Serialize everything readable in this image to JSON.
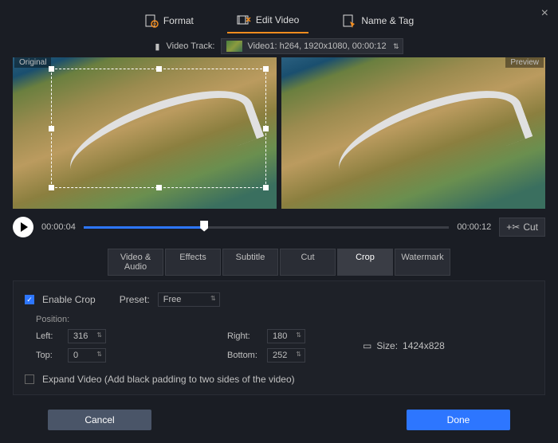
{
  "topTabs": {
    "format": "Format",
    "editVideo": "Edit Video",
    "nameTag": "Name & Tag"
  },
  "track": {
    "label": "Video Track:",
    "value": "Video1: h264, 1920x1080, 00:00:12"
  },
  "previews": {
    "original": "Original",
    "preview": "Preview"
  },
  "player": {
    "curTime": "00:00:04",
    "totTime": "00:00:12",
    "progressPct": 33,
    "cutLabel": "Cut"
  },
  "subTabs": [
    "Video & Audio",
    "Effects",
    "Subtitle",
    "Cut",
    "Crop",
    "Watermark"
  ],
  "crop": {
    "enableLabel": "Enable Crop",
    "presetLabel": "Preset:",
    "presetValue": "Free",
    "positionLabel": "Position:",
    "leftLabel": "Left:",
    "leftVal": "316",
    "topLabel": "Top:",
    "topVal": "0",
    "rightLabel": "Right:",
    "rightVal": "180",
    "bottomLabel": "Bottom:",
    "bottomVal": "252",
    "sizeLabel": "Size:",
    "sizeVal": "1424x828",
    "expandLabel": "Expand Video (Add black padding to two sides of the video)"
  },
  "buttons": {
    "cancel": "Cancel",
    "done": "Done"
  }
}
